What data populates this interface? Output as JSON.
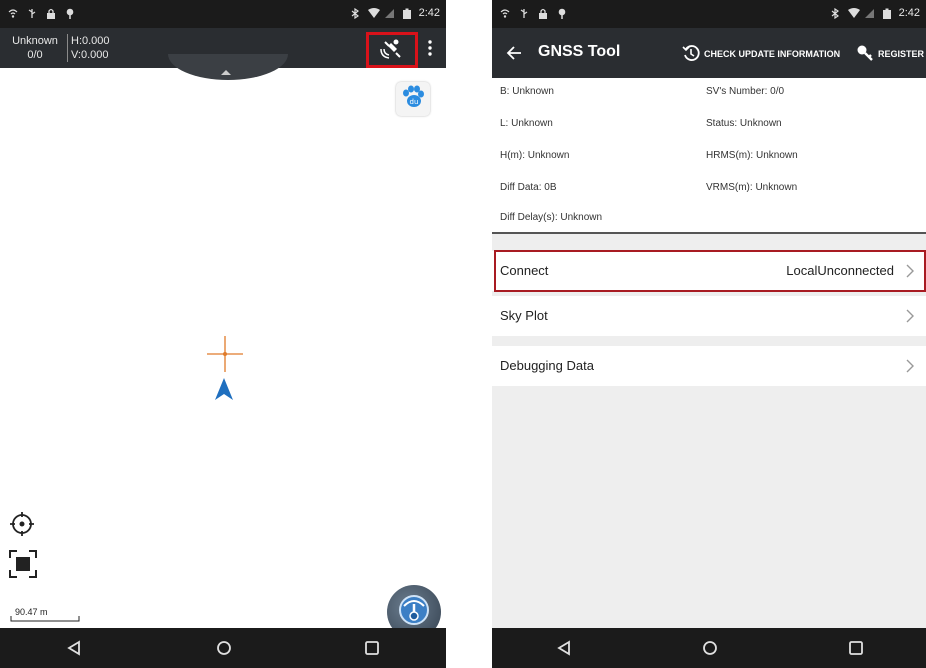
{
  "left_screen": {
    "status_bar": {
      "time": "2:42"
    },
    "position_status": {
      "solution": "Unknown",
      "satellites": "0/0",
      "h_precision": "H:0.000",
      "v_precision": "V:0.000"
    },
    "map": {
      "scale_label": "90.47 m"
    },
    "icons": {
      "satellite": "satellite-icon",
      "menu": "more-vertical-icon",
      "baidu": "baidu-paw-icon",
      "crosshair": "crosshair-icon",
      "location": "location-arrow-icon",
      "locate": "locate-icon",
      "fullscreen": "fullscreen-icon",
      "navigation": "navigation-icon"
    }
  },
  "right_screen": {
    "status_bar": {
      "time": "2:42"
    },
    "app_bar": {
      "title": "GNSS Tool",
      "check_update_label": "CHECK UPDATE INFORMATION",
      "register_label": "REGISTER"
    },
    "info": {
      "b": "B:  Unknown",
      "sv_number": "SV's Number:  0/0",
      "l": "L:  Unknown",
      "status": "Status:  Unknown",
      "h": "H(m):  Unknown",
      "hrms": "HRMS(m):  Unknown",
      "diff_data": "Diff Data:  0B",
      "vrms": "VRMS(m):  Unknown",
      "diff_delay": "Diff Delay(s):  Unknown"
    },
    "menu": [
      {
        "label": "Connect",
        "value": "LocalUnconnected"
      },
      {
        "label": "Sky Plot",
        "value": ""
      },
      {
        "label": "Debugging Data",
        "value": ""
      }
    ]
  },
  "colors": {
    "toolbar": "#2a2d31",
    "system_bar": "#1b1b1b",
    "highlight_red": "#d9121a",
    "marker_orange": "#e07b2a",
    "arrow_blue": "#1f6fbf"
  }
}
